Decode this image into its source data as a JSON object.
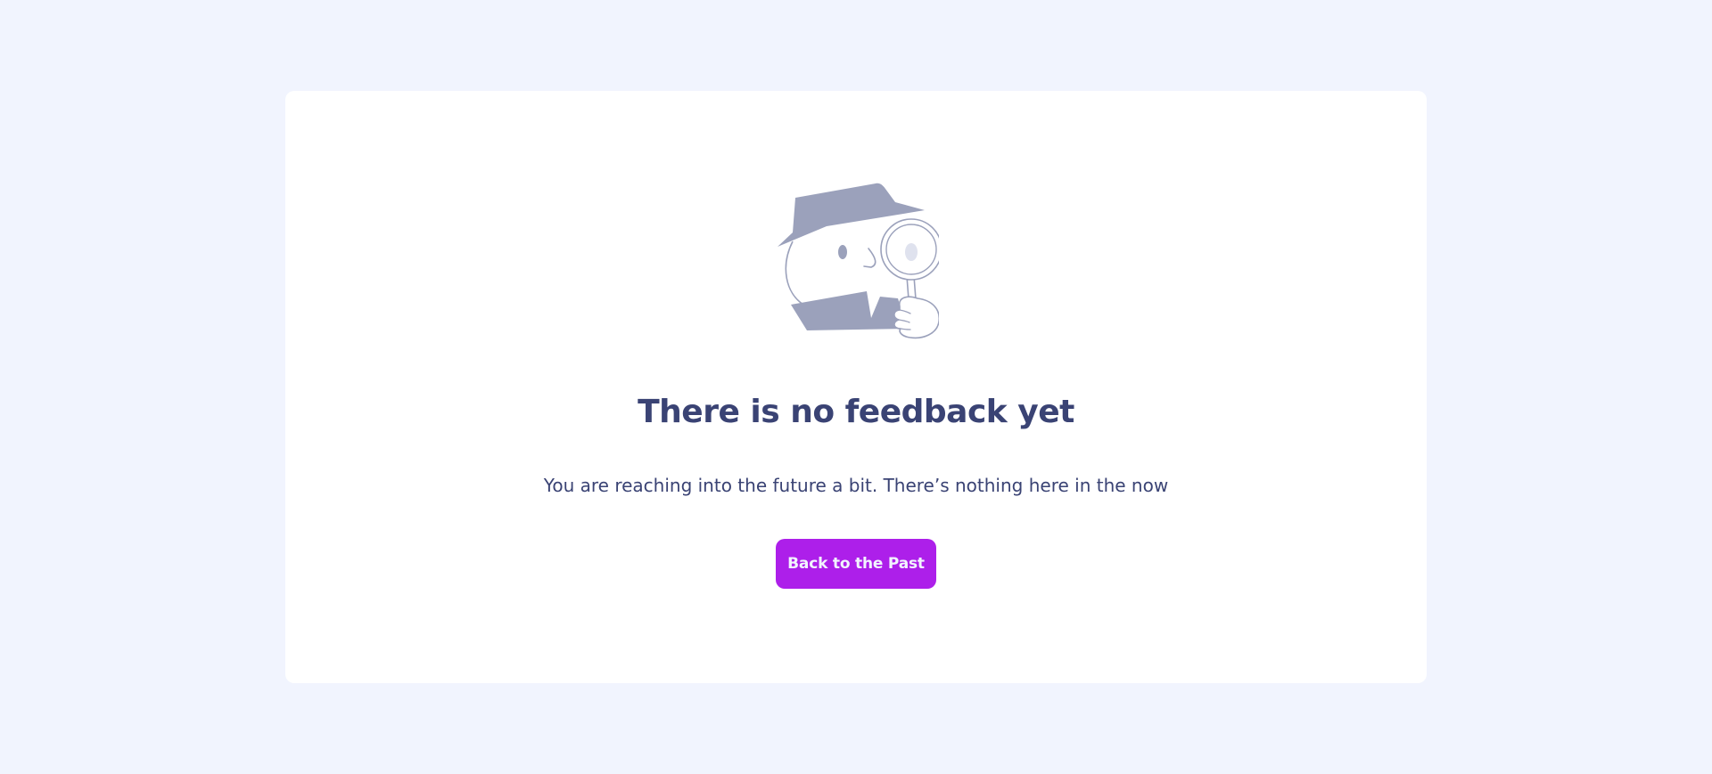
{
  "empty_state": {
    "illustration": "detective-magnifier-illustration",
    "title": "There is no feedback yet",
    "message": "You are reaching into the future a bit. There’s nothing here in the now",
    "button_label": "Back to the Past"
  },
  "colors": {
    "page_background": "#f1f4fe",
    "card_background": "#ffffff",
    "text_primary": "#3a4374",
    "illustration": "#9ba1bb",
    "button_background": "#ad1fea",
    "button_text": "#f2f4fe"
  }
}
